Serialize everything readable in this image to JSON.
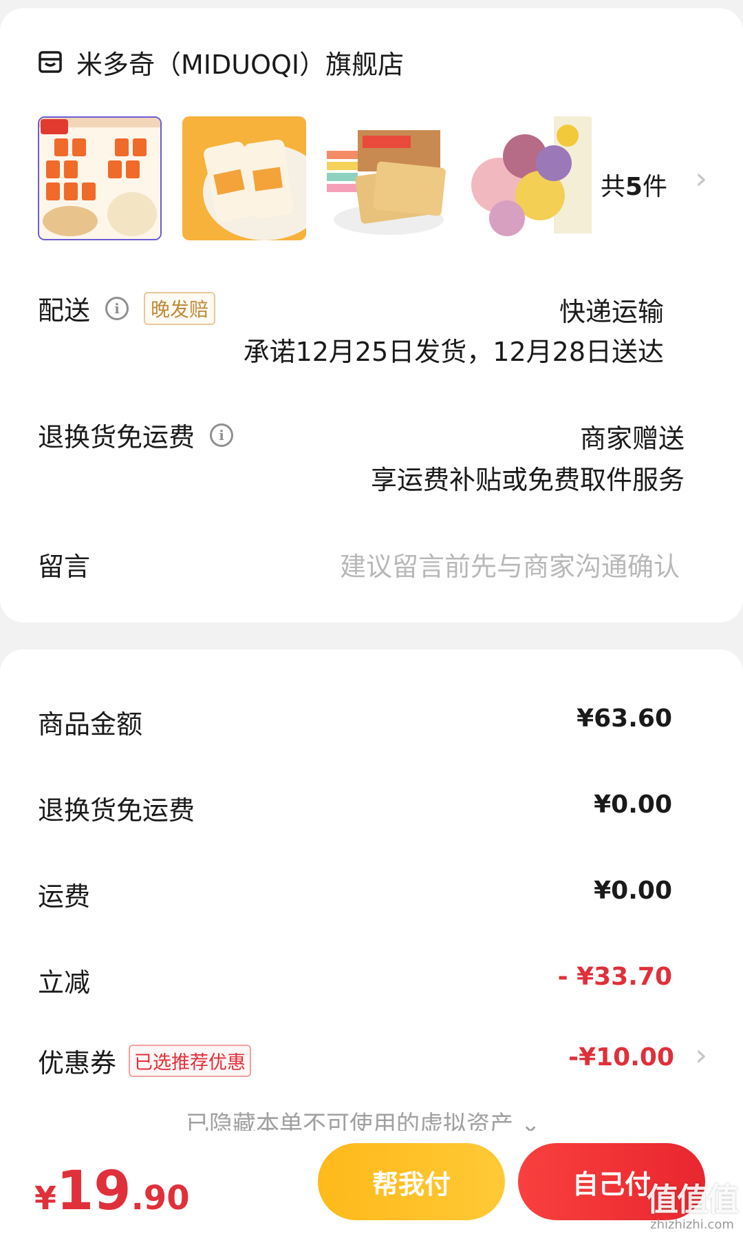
{
  "shop": {
    "name": "米多奇（MIDUOQI）旗舰店",
    "icon": "store-icon",
    "item_count_prefix": "共",
    "item_count": "5",
    "item_count_suffix": "件"
  },
  "delivery": {
    "label": "配送",
    "tag": "晚发赔",
    "method": "快递运输",
    "promise": "承诺12月25日发货，12月28日送达"
  },
  "return_shipping": {
    "label": "退换货免运费",
    "value": "商家赠送",
    "desc": "享运费补贴或免费取件服务"
  },
  "message": {
    "label": "留言",
    "placeholder": "建议留言前先与商家沟通确认"
  },
  "price_summary": {
    "goods_label": "商品金额",
    "goods_value": "¥63.60",
    "return_label": "退换货免运费",
    "return_value": "¥0.00",
    "shipping_label": "运费",
    "shipping_value": "¥0.00",
    "discount_label": "立减",
    "discount_value": "- ¥33.70",
    "coupon_label": "优惠券",
    "coupon_tag": "已选推荐优惠",
    "coupon_value": "-¥10.00",
    "hidden_note": "已隐藏本单不可使用的虚拟资产"
  },
  "footer": {
    "currency": "¥",
    "total_int": "19",
    "total_dec": ".90",
    "help_pay": "帮我付",
    "self_pay": "自己付"
  },
  "watermark": {
    "main": "值值值",
    "sub": "zhizhizhi.com"
  },
  "colors": {
    "accent_red": "#e0303a",
    "help_button": "#ffbe1f",
    "self_button": "#f0333a"
  }
}
